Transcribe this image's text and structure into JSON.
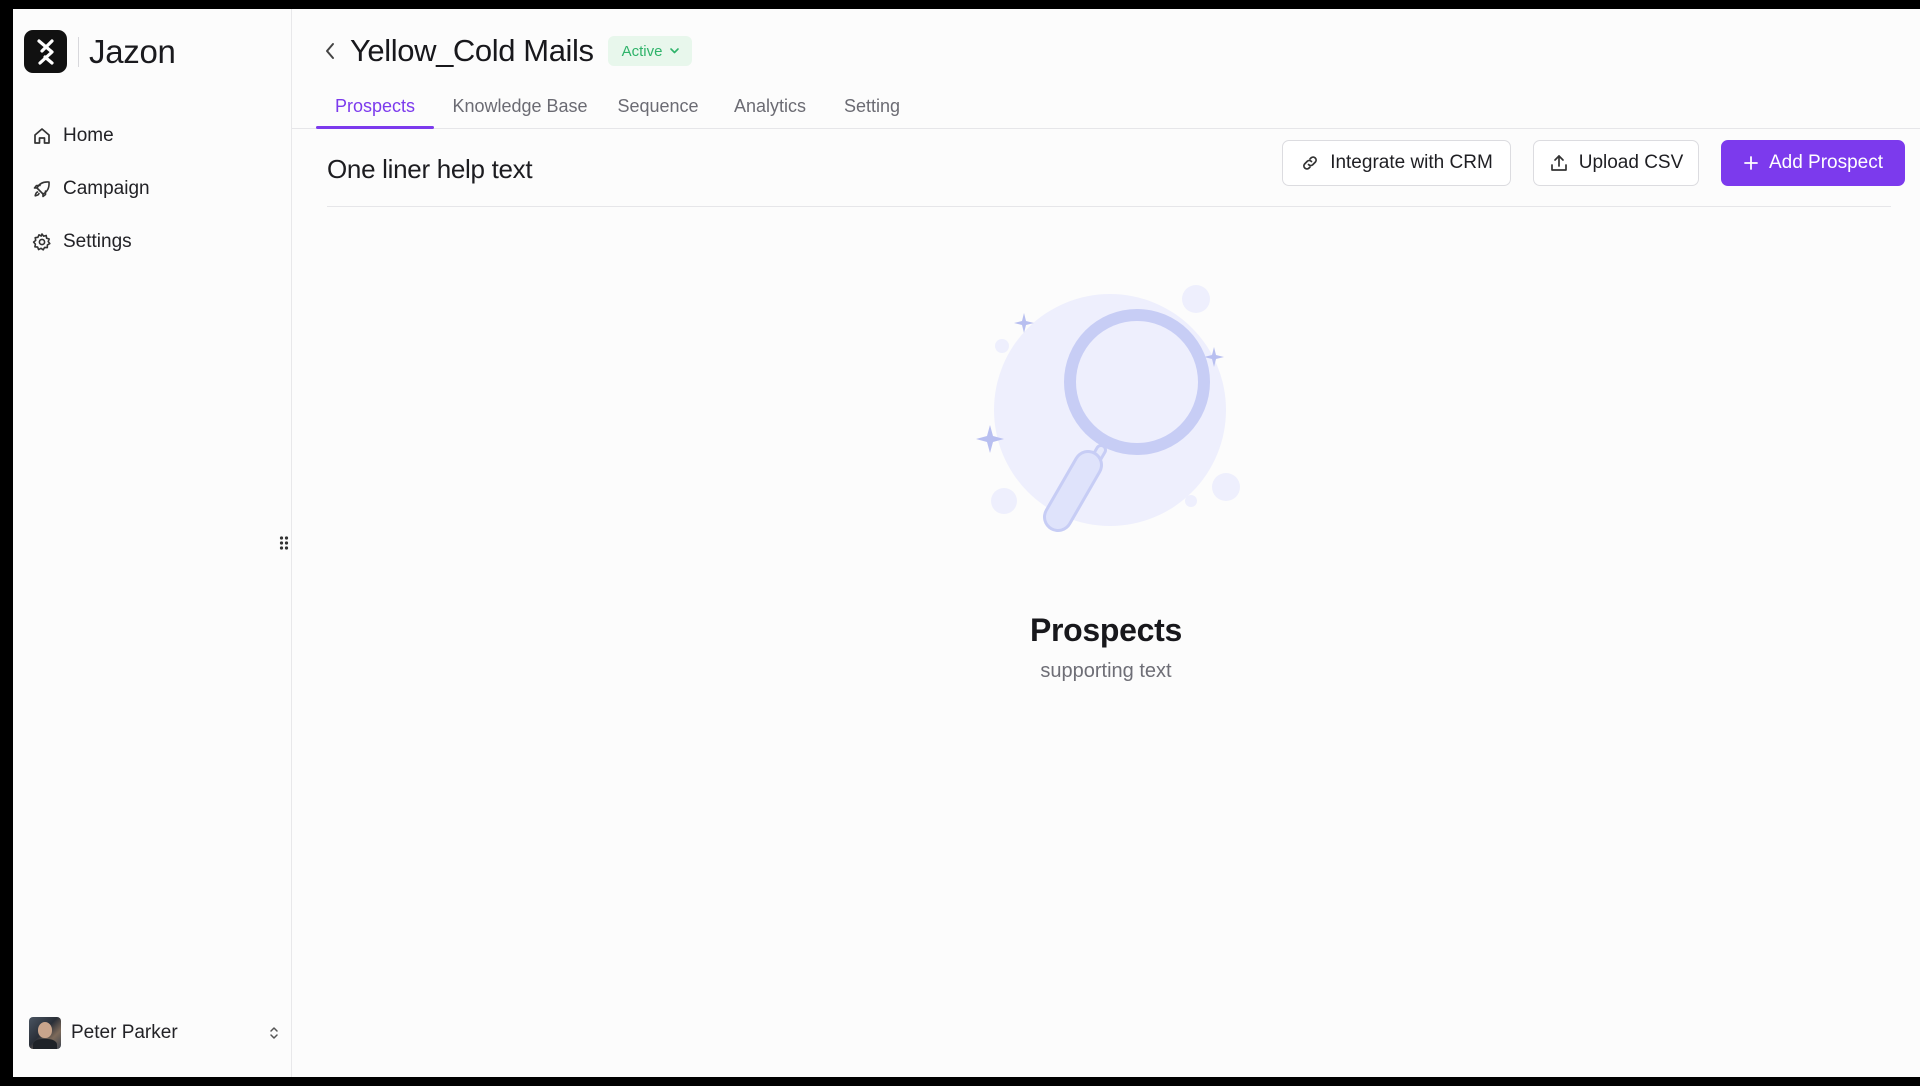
{
  "app": {
    "name": "Jazon"
  },
  "sidebar": {
    "items": [
      {
        "label": "Home",
        "icon": "home-icon"
      },
      {
        "label": "Campaign",
        "icon": "rocket-icon"
      },
      {
        "label": "Settings",
        "icon": "gear-icon"
      }
    ],
    "user": {
      "name": "Peter Parker"
    }
  },
  "header": {
    "title": "Yellow_Cold Mails",
    "status": "Active"
  },
  "tabs": [
    {
      "label": "Prospects",
      "active": true
    },
    {
      "label": "Knowledge Base",
      "active": false
    },
    {
      "label": "Sequence",
      "active": false
    },
    {
      "label": "Analytics",
      "active": false
    },
    {
      "label": "Setting",
      "active": false
    }
  ],
  "toolbar": {
    "help_text": "One liner help text",
    "integrate_label": "Integrate with CRM",
    "upload_label": "Upload CSV",
    "add_label": "Add Prospect"
  },
  "empty_state": {
    "title": "Prospects",
    "subtitle": "supporting text"
  },
  "colors": {
    "accent": "#7c3aed",
    "status_bg": "#e8f7ec",
    "status_text": "#2fb36a",
    "illustration": "#c7cdf5"
  }
}
